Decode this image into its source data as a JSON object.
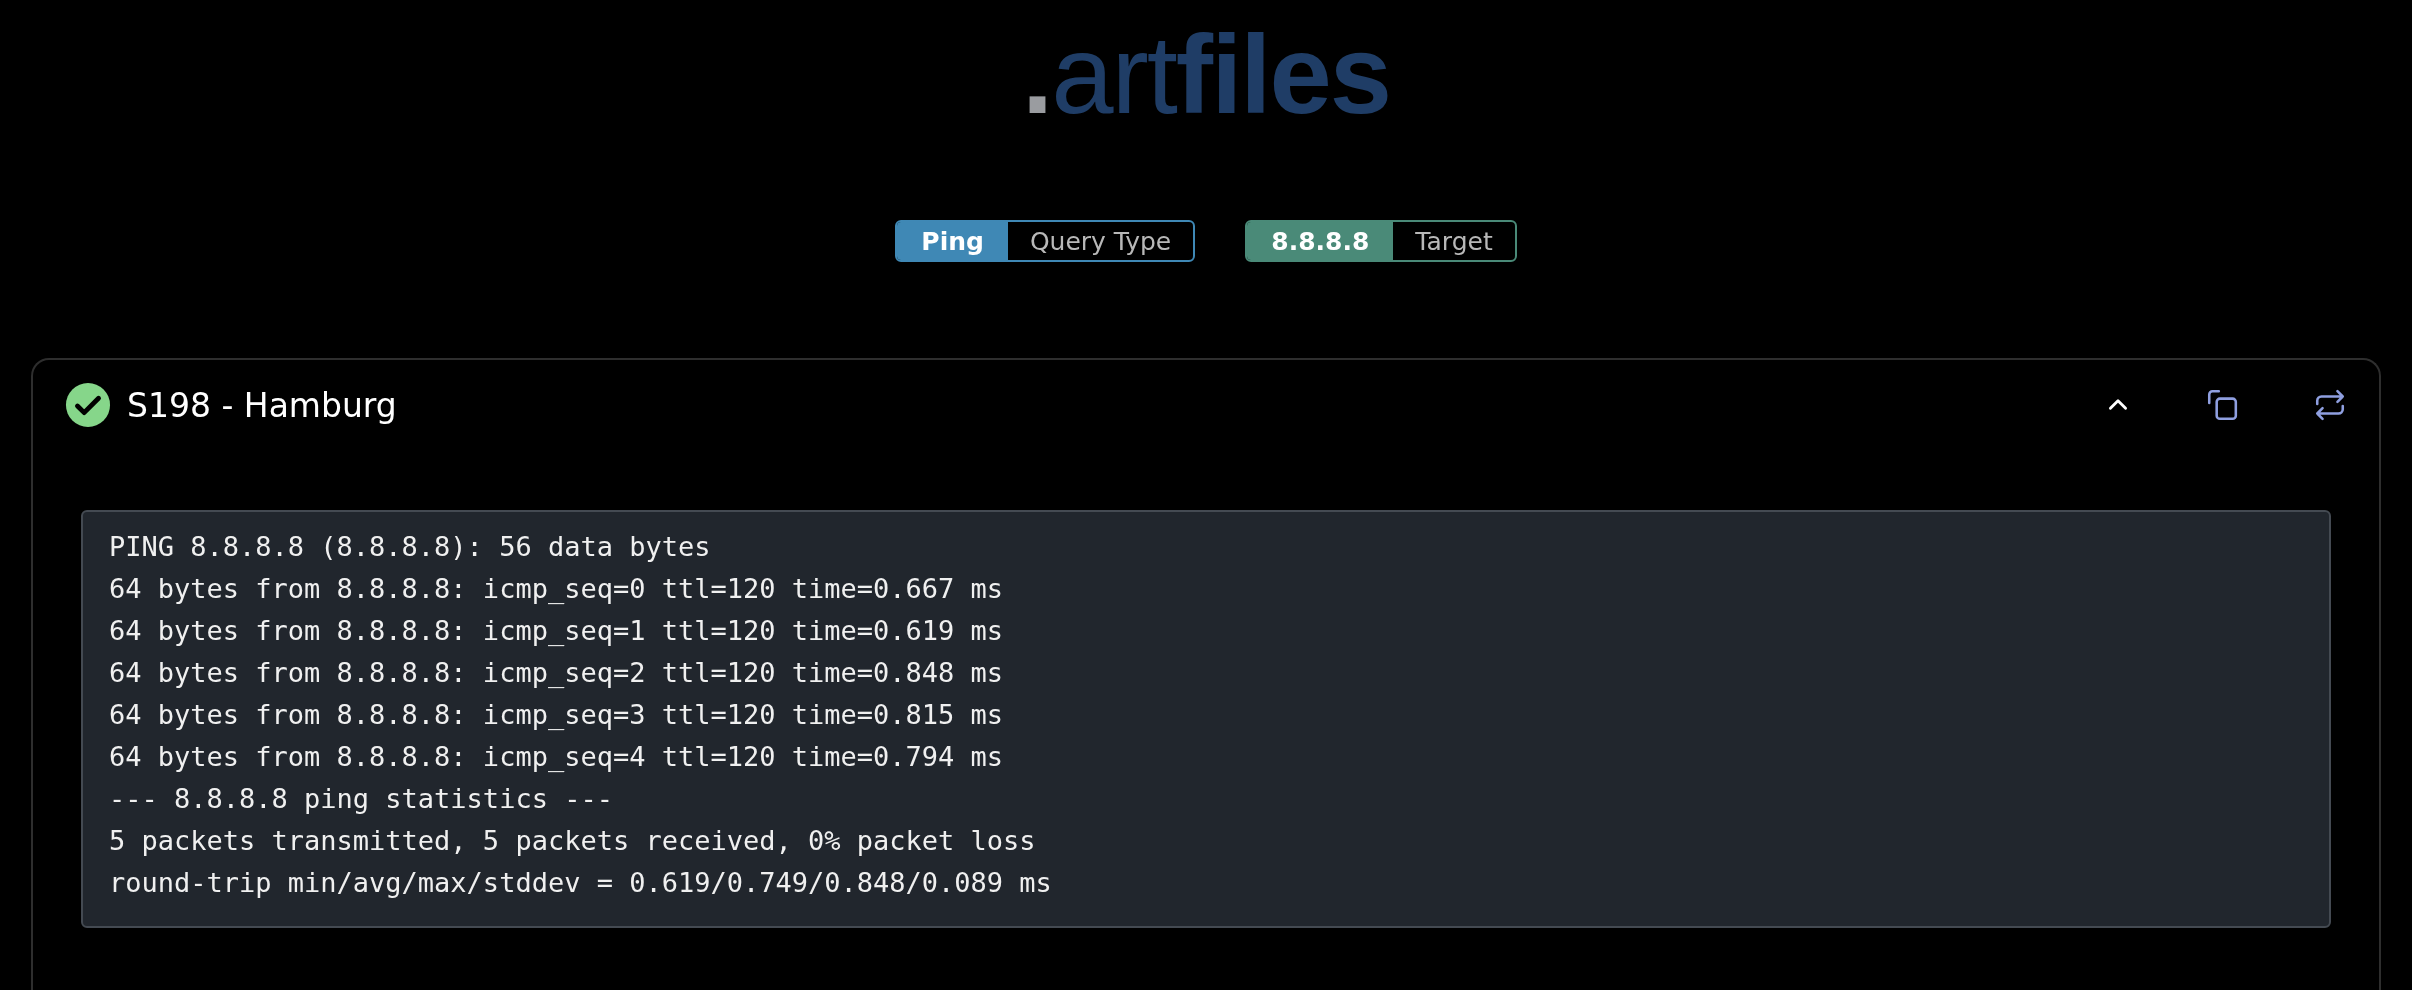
{
  "logo": [
    {
      "text": ".",
      "kind": "dot"
    },
    {
      "text": "art",
      "kind": "light"
    },
    {
      "text": "files",
      "kind": "bold"
    }
  ],
  "tags": [
    {
      "value": "Ping",
      "label": "Query Type",
      "color": "#3f88b5"
    },
    {
      "value": "8.8.8.8",
      "label": "Target",
      "color": "#4a8a78"
    }
  ],
  "result": {
    "succeeded": true,
    "title": "S198 - Hamburg",
    "expanded": true,
    "output": [
      "PING 8.8.8.8 (8.8.8.8): 56 data bytes",
      "64 bytes from 8.8.8.8: icmp_seq=0 ttl=120 time=0.667 ms",
      "64 bytes from 8.8.8.8: icmp_seq=1 ttl=120 time=0.619 ms",
      "64 bytes from 8.8.8.8: icmp_seq=2 ttl=120 time=0.848 ms",
      "64 bytes from 8.8.8.8: icmp_seq=3 ttl=120 time=0.815 ms",
      "64 bytes from 8.8.8.8: icmp_seq=4 ttl=120 time=0.794 ms",
      "--- 8.8.8.8 ping statistics ---",
      "5 packets transmitted, 5 packets received, 0% packet loss",
      "round-trip min/avg/max/stddev = 0.619/0.749/0.848/0.089 ms"
    ]
  }
}
